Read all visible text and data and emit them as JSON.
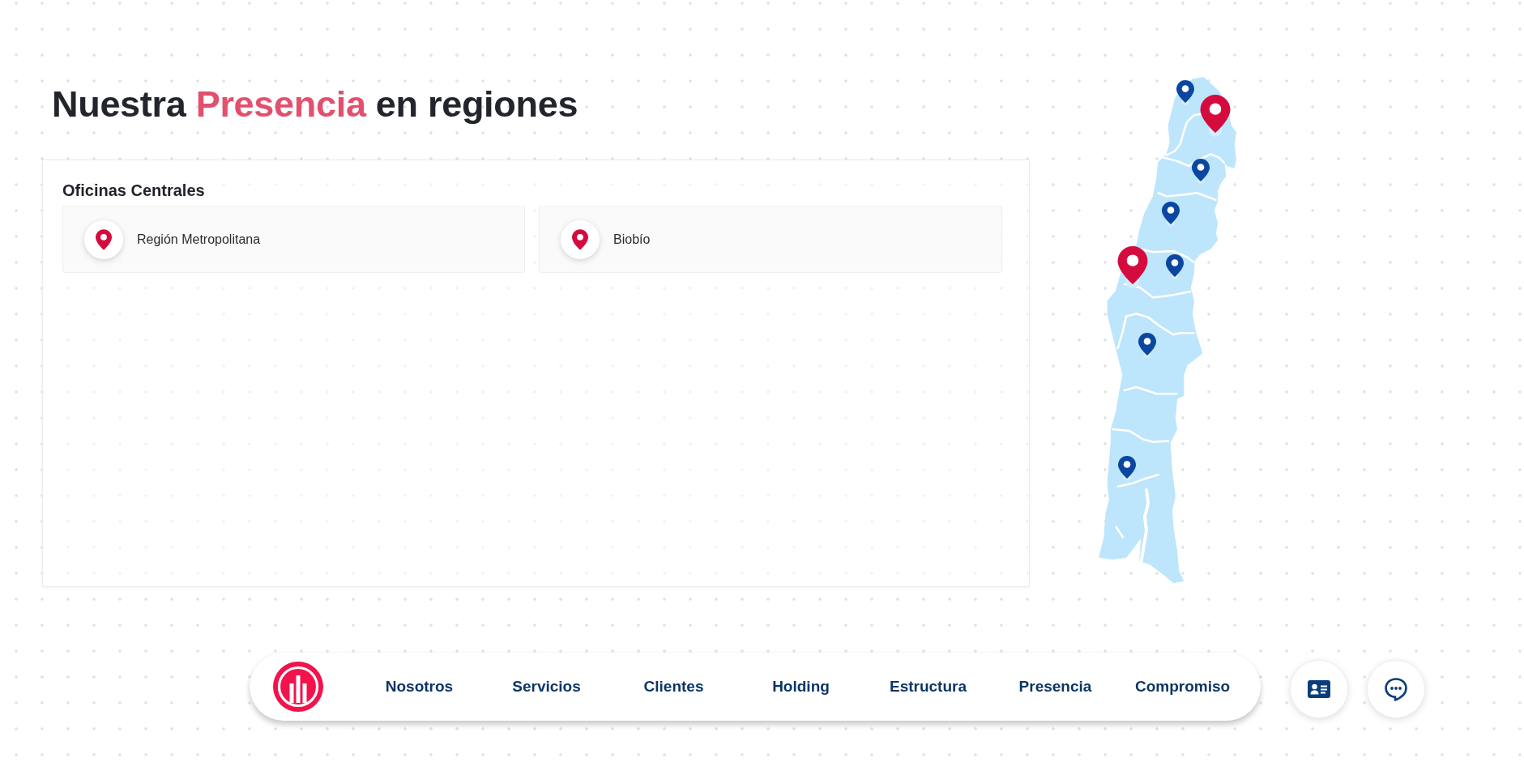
{
  "title": {
    "parts": [
      {
        "text": "Nuestra ",
        "highlight": false
      },
      {
        "text": "Presencia",
        "highlight": true
      },
      {
        "text": " en regiones",
        "highlight": false
      }
    ]
  },
  "offices_panel": {
    "heading": "Oficinas Centrales",
    "offices": [
      {
        "name": "Región Metropolitana"
      },
      {
        "name": "Biobío"
      }
    ]
  },
  "map": {
    "markers": [
      {
        "kind": "region",
        "color": "#0b47a0"
      },
      {
        "kind": "office",
        "color": "#d50b3e"
      },
      {
        "kind": "region",
        "color": "#0b47a0"
      },
      {
        "kind": "region",
        "color": "#0b47a0"
      },
      {
        "kind": "office",
        "color": "#d50b3e"
      },
      {
        "kind": "region",
        "color": "#0b47a0"
      },
      {
        "kind": "region",
        "color": "#0b47a0"
      },
      {
        "kind": "region",
        "color": "#0b47a0"
      }
    ]
  },
  "nav": {
    "items": [
      {
        "label": "Nosotros"
      },
      {
        "label": "Servicios"
      },
      {
        "label": "Clientes"
      },
      {
        "label": "Holding"
      },
      {
        "label": "Estructura"
      },
      {
        "label": "Presencia"
      },
      {
        "label": "Compromiso"
      }
    ]
  }
}
